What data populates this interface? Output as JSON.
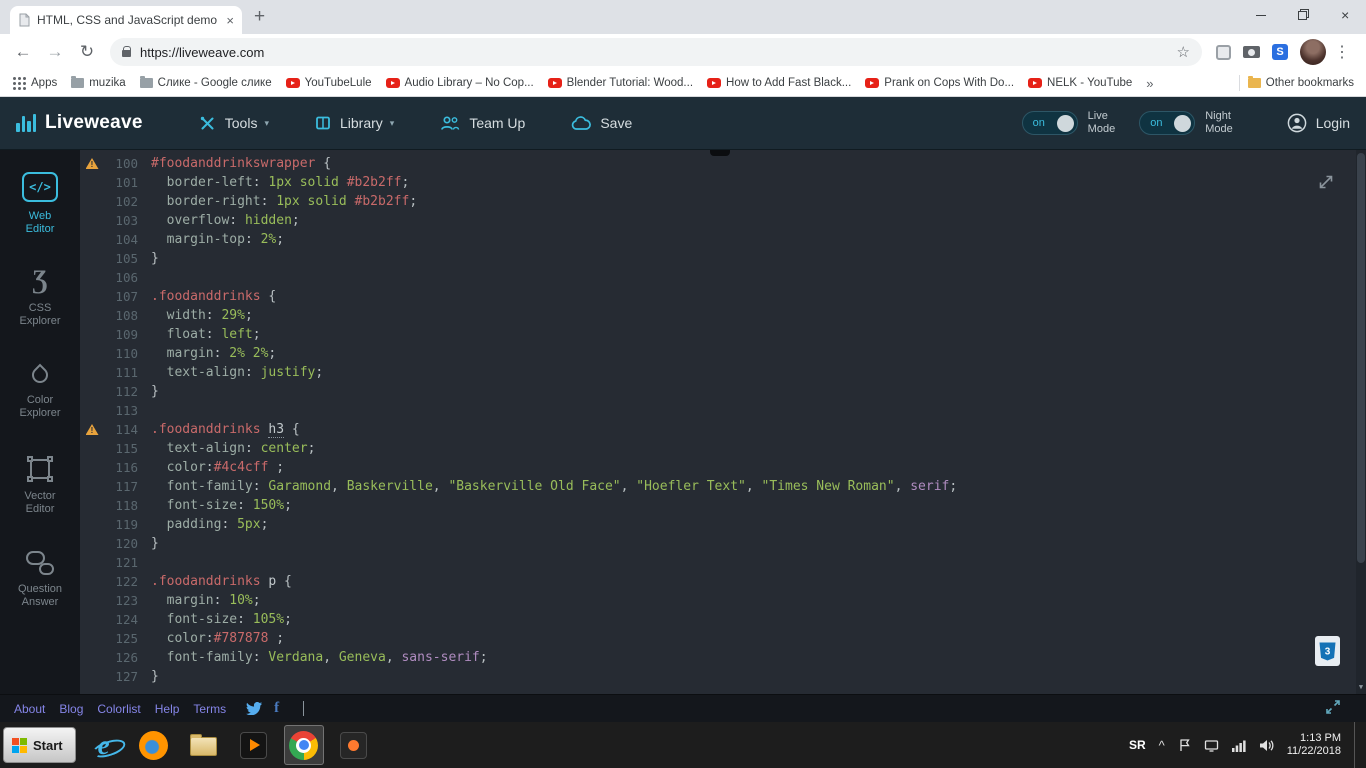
{
  "icons": {
    "back": "←",
    "forward": "→",
    "refresh": "↻",
    "star": "☆",
    "kebab": "⋮",
    "new_tab": "+",
    "tab_close": "×",
    "overflow": "»",
    "chevron_down": "▾",
    "caret_up": "^",
    "scroll_down": "▼",
    "s_ext": "S",
    "facebook_f": "f",
    "web_editor_glyph": "</>",
    "css_explorer_glyph": "Ʒ"
  },
  "colors": {
    "accent_cyan": "#3bbdde",
    "selector_red": "#c96a6a",
    "value_green": "#99bd5a",
    "keyword_purple": "#b08cc0",
    "warning_orange": "#e8a33d",
    "youtube_red": "#e62117"
  },
  "browser": {
    "tab_title": "HTML, CSS and JavaScript demo - Li",
    "url": "https://liveweave.com",
    "bookmarks": {
      "apps_label": "Apps",
      "items": [
        {
          "label": "muzika",
          "icon": "folder"
        },
        {
          "label": "Слике - Google слике",
          "icon": "folder"
        },
        {
          "label": "YouTubeLule",
          "icon": "youtube"
        },
        {
          "label": "Audio Library – No Cop...",
          "icon": "youtube"
        },
        {
          "label": "Blender Tutorial: Wood...",
          "icon": "youtube"
        },
        {
          "label": "How to Add Fast Black...",
          "icon": "youtube"
        },
        {
          "label": "Prank on Cops With Do...",
          "icon": "youtube"
        },
        {
          "label": "NELK - YouTube",
          "icon": "youtube"
        }
      ],
      "other_label": "Other bookmarks"
    }
  },
  "liveweave": {
    "brand": "Liveweave",
    "menu": [
      {
        "label": "Tools"
      },
      {
        "label": "Library"
      },
      {
        "label": "Team Up"
      },
      {
        "label": "Save"
      }
    ],
    "toggles": [
      {
        "state": "on",
        "line1": "Live",
        "line2": "Mode"
      },
      {
        "state": "on",
        "line1": "Night",
        "line2": "Mode"
      }
    ],
    "login_label": "Login"
  },
  "sidebar": {
    "items": [
      {
        "line1": "Web",
        "line2": "Editor"
      },
      {
        "line1": "CSS",
        "line2": "Explorer"
      },
      {
        "line1": "Color",
        "line2": "Explorer"
      },
      {
        "line1": "Vector",
        "line2": "Editor"
      },
      {
        "line1": "Question",
        "line2": "Answer"
      }
    ]
  },
  "editor": {
    "badge": "3",
    "lines": [
      {
        "n": "100",
        "w": true,
        "t": [
          [
            "sel",
            "#foodanddrinkswrapper"
          ],
          [
            "pun",
            " {"
          ]
        ]
      },
      {
        "n": "101",
        "t": [
          [
            "pun",
            "  "
          ],
          [
            "prop",
            "border-left"
          ],
          [
            "pun",
            ": "
          ],
          [
            "val",
            "1px solid "
          ],
          [
            "hex",
            "#b2b2ff"
          ],
          [
            "pun",
            ";"
          ]
        ]
      },
      {
        "n": "102",
        "t": [
          [
            "pun",
            "  "
          ],
          [
            "prop",
            "border-right"
          ],
          [
            "pun",
            ": "
          ],
          [
            "val",
            "1px solid "
          ],
          [
            "hex",
            "#b2b2ff"
          ],
          [
            "pun",
            ";"
          ]
        ]
      },
      {
        "n": "103",
        "t": [
          [
            "pun",
            "  "
          ],
          [
            "prop",
            "overflow"
          ],
          [
            "pun",
            ": "
          ],
          [
            "val",
            "hidden"
          ],
          [
            "pun",
            ";"
          ]
        ]
      },
      {
        "n": "104",
        "t": [
          [
            "pun",
            "  "
          ],
          [
            "prop",
            "margin-top"
          ],
          [
            "pun",
            ": "
          ],
          [
            "val",
            "2%"
          ],
          [
            "pun",
            ";"
          ]
        ]
      },
      {
        "n": "105",
        "t": [
          [
            "pun",
            "}"
          ]
        ]
      },
      {
        "n": "106",
        "t": []
      },
      {
        "n": "107",
        "t": [
          [
            "sel",
            ".foodanddrinks"
          ],
          [
            "pun",
            " {"
          ]
        ]
      },
      {
        "n": "108",
        "t": [
          [
            "pun",
            "  "
          ],
          [
            "prop",
            "width"
          ],
          [
            "pun",
            ": "
          ],
          [
            "val",
            "29%"
          ],
          [
            "pun",
            ";"
          ]
        ]
      },
      {
        "n": "109",
        "t": [
          [
            "pun",
            "  "
          ],
          [
            "prop",
            "float"
          ],
          [
            "pun",
            ": "
          ],
          [
            "val",
            "left"
          ],
          [
            "pun",
            ";"
          ]
        ]
      },
      {
        "n": "110",
        "t": [
          [
            "pun",
            "  "
          ],
          [
            "prop",
            "margin"
          ],
          [
            "pun",
            ": "
          ],
          [
            "val",
            "2% 2%"
          ],
          [
            "pun",
            ";"
          ]
        ]
      },
      {
        "n": "111",
        "t": [
          [
            "pun",
            "  "
          ],
          [
            "prop",
            "text-align"
          ],
          [
            "pun",
            ": "
          ],
          [
            "val",
            "justify"
          ],
          [
            "pun",
            ";"
          ]
        ]
      },
      {
        "n": "112",
        "t": [
          [
            "pun",
            "}"
          ]
        ]
      },
      {
        "n": "113",
        "t": []
      },
      {
        "n": "114",
        "w": true,
        "t": [
          [
            "sel",
            ".foodanddrinks"
          ],
          [
            "pun",
            " "
          ],
          [
            "tagw",
            "h3"
          ],
          [
            "pun",
            " {"
          ]
        ]
      },
      {
        "n": "115",
        "t": [
          [
            "pun",
            "  "
          ],
          [
            "prop",
            "text-align"
          ],
          [
            "pun",
            ": "
          ],
          [
            "val",
            "center"
          ],
          [
            "pun",
            ";"
          ]
        ]
      },
      {
        "n": "116",
        "t": [
          [
            "pun",
            "  "
          ],
          [
            "prop",
            "color"
          ],
          [
            "pun",
            ":"
          ],
          [
            "hex",
            "#4c4cff"
          ],
          [
            "pun",
            " ;"
          ]
        ]
      },
      {
        "n": "117",
        "t": [
          [
            "pun",
            "  "
          ],
          [
            "prop",
            "font-family"
          ],
          [
            "pun",
            ": "
          ],
          [
            "val",
            "Garamond"
          ],
          [
            "pun",
            ", "
          ],
          [
            "val",
            "Baskerville"
          ],
          [
            "pun",
            ", "
          ],
          [
            "str",
            "\"Baskerville Old Face\""
          ],
          [
            "pun",
            ", "
          ],
          [
            "str",
            "\"Hoefler Text\""
          ],
          [
            "pun",
            ", "
          ],
          [
            "str",
            "\"Times New Roman\""
          ],
          [
            "pun",
            ", "
          ],
          [
            "kw",
            "serif"
          ],
          [
            "pun",
            ";"
          ]
        ]
      },
      {
        "n": "118",
        "t": [
          [
            "pun",
            "  "
          ],
          [
            "prop",
            "font-size"
          ],
          [
            "pun",
            ": "
          ],
          [
            "val",
            "150%"
          ],
          [
            "pun",
            ";"
          ]
        ]
      },
      {
        "n": "119",
        "t": [
          [
            "pun",
            "  "
          ],
          [
            "prop",
            "padding"
          ],
          [
            "pun",
            ": "
          ],
          [
            "val",
            "5px"
          ],
          [
            "pun",
            ";"
          ]
        ]
      },
      {
        "n": "120",
        "t": [
          [
            "pun",
            "}"
          ]
        ]
      },
      {
        "n": "121",
        "t": []
      },
      {
        "n": "122",
        "t": [
          [
            "sel",
            ".foodanddrinks"
          ],
          [
            "pun",
            " "
          ],
          [
            "tag",
            "p"
          ],
          [
            "pun",
            " {"
          ]
        ]
      },
      {
        "n": "123",
        "t": [
          [
            "pun",
            "  "
          ],
          [
            "prop",
            "margin"
          ],
          [
            "pun",
            ": "
          ],
          [
            "val",
            "10%"
          ],
          [
            "pun",
            ";"
          ]
        ]
      },
      {
        "n": "124",
        "t": [
          [
            "pun",
            "  "
          ],
          [
            "prop",
            "font-size"
          ],
          [
            "pun",
            ": "
          ],
          [
            "val",
            "105%"
          ],
          [
            "pun",
            ";"
          ]
        ]
      },
      {
        "n": "125",
        "t": [
          [
            "pun",
            "  "
          ],
          [
            "prop",
            "color"
          ],
          [
            "pun",
            ":"
          ],
          [
            "hex",
            "#787878"
          ],
          [
            "pun",
            " ;"
          ]
        ]
      },
      {
        "n": "126",
        "t": [
          [
            "pun",
            "  "
          ],
          [
            "prop",
            "font-family"
          ],
          [
            "pun",
            ": "
          ],
          [
            "val",
            "Verdana"
          ],
          [
            "pun",
            ", "
          ],
          [
            "val",
            "Geneva"
          ],
          [
            "pun",
            ", "
          ],
          [
            "kw",
            "sans-serif"
          ],
          [
            "pun",
            ";"
          ]
        ]
      },
      {
        "n": "127",
        "t": [
          [
            "pun",
            "}"
          ]
        ]
      }
    ]
  },
  "footer": {
    "links": [
      "About",
      "Blog",
      "Colorlist",
      "Help",
      "Terms"
    ]
  },
  "taskbar": {
    "start_label": "Start",
    "apps": [
      {
        "icon": "ie"
      },
      {
        "icon": "firefox"
      },
      {
        "icon": "files"
      },
      {
        "icon": "player"
      },
      {
        "icon": "chrome",
        "active": true
      },
      {
        "icon": "darkapp"
      }
    ],
    "language": "SR",
    "time": "1:13 PM",
    "date": "11/22/2018"
  }
}
